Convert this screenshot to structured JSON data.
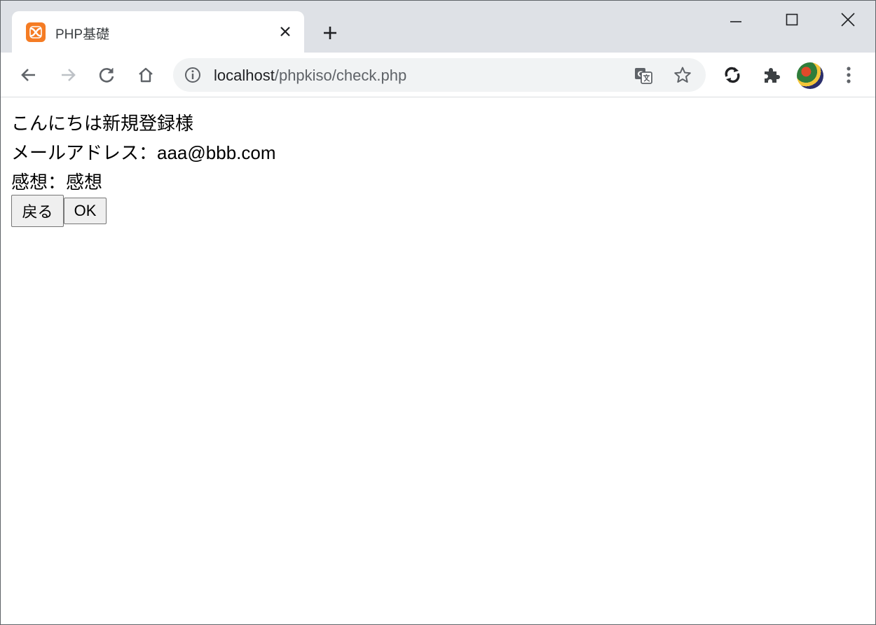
{
  "browser": {
    "tab_title": "PHP基礎",
    "url_host": "localhost",
    "url_path": "/phpkiso/check.php",
    "favicon": "xampp-icon",
    "accent_color": "#f57c24"
  },
  "page": {
    "greeting": "こんにちは新規登録様",
    "email_line": "メールアドレス：aaa@bbb.com",
    "impression_line": "感想：感想",
    "back_button": "戻る",
    "ok_button": "OK"
  }
}
